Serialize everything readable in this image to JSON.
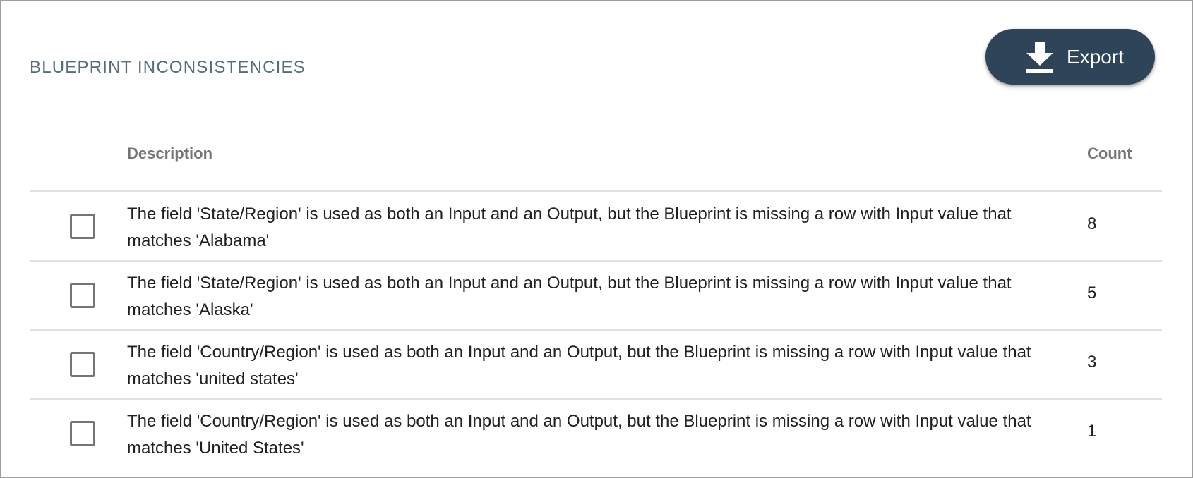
{
  "section": {
    "title": "BLUEPRINT INCONSISTENCIES"
  },
  "toolbar": {
    "export_label": "Export",
    "export_icon": "download-icon"
  },
  "table": {
    "columns": {
      "description": "Description",
      "count": "Count"
    },
    "rows": [
      {
        "description": "The field 'State/Region' is used as both an Input and an Output, but the Blueprint is missing a row with Input value that matches 'Alabama'",
        "count": "8",
        "checked": false
      },
      {
        "description": "The field 'State/Region' is used as both an Input and an Output, but the Blueprint is missing a row with Input value that matches 'Alaska'",
        "count": "5",
        "checked": false
      },
      {
        "description": "The field 'Country/Region' is used as both an Input and an Output, but the Blueprint is missing a row with Input value that matches 'united states'",
        "count": "3",
        "checked": false
      },
      {
        "description": "The field 'Country/Region' is used as both an Input and an Output, but the Blueprint is missing a row with Input value that matches 'United States'",
        "count": "1",
        "checked": false
      }
    ]
  },
  "colors": {
    "accent": "#2d4459",
    "title": "#546e7a",
    "header_text": "#757575",
    "divider": "#e0e0e0"
  }
}
